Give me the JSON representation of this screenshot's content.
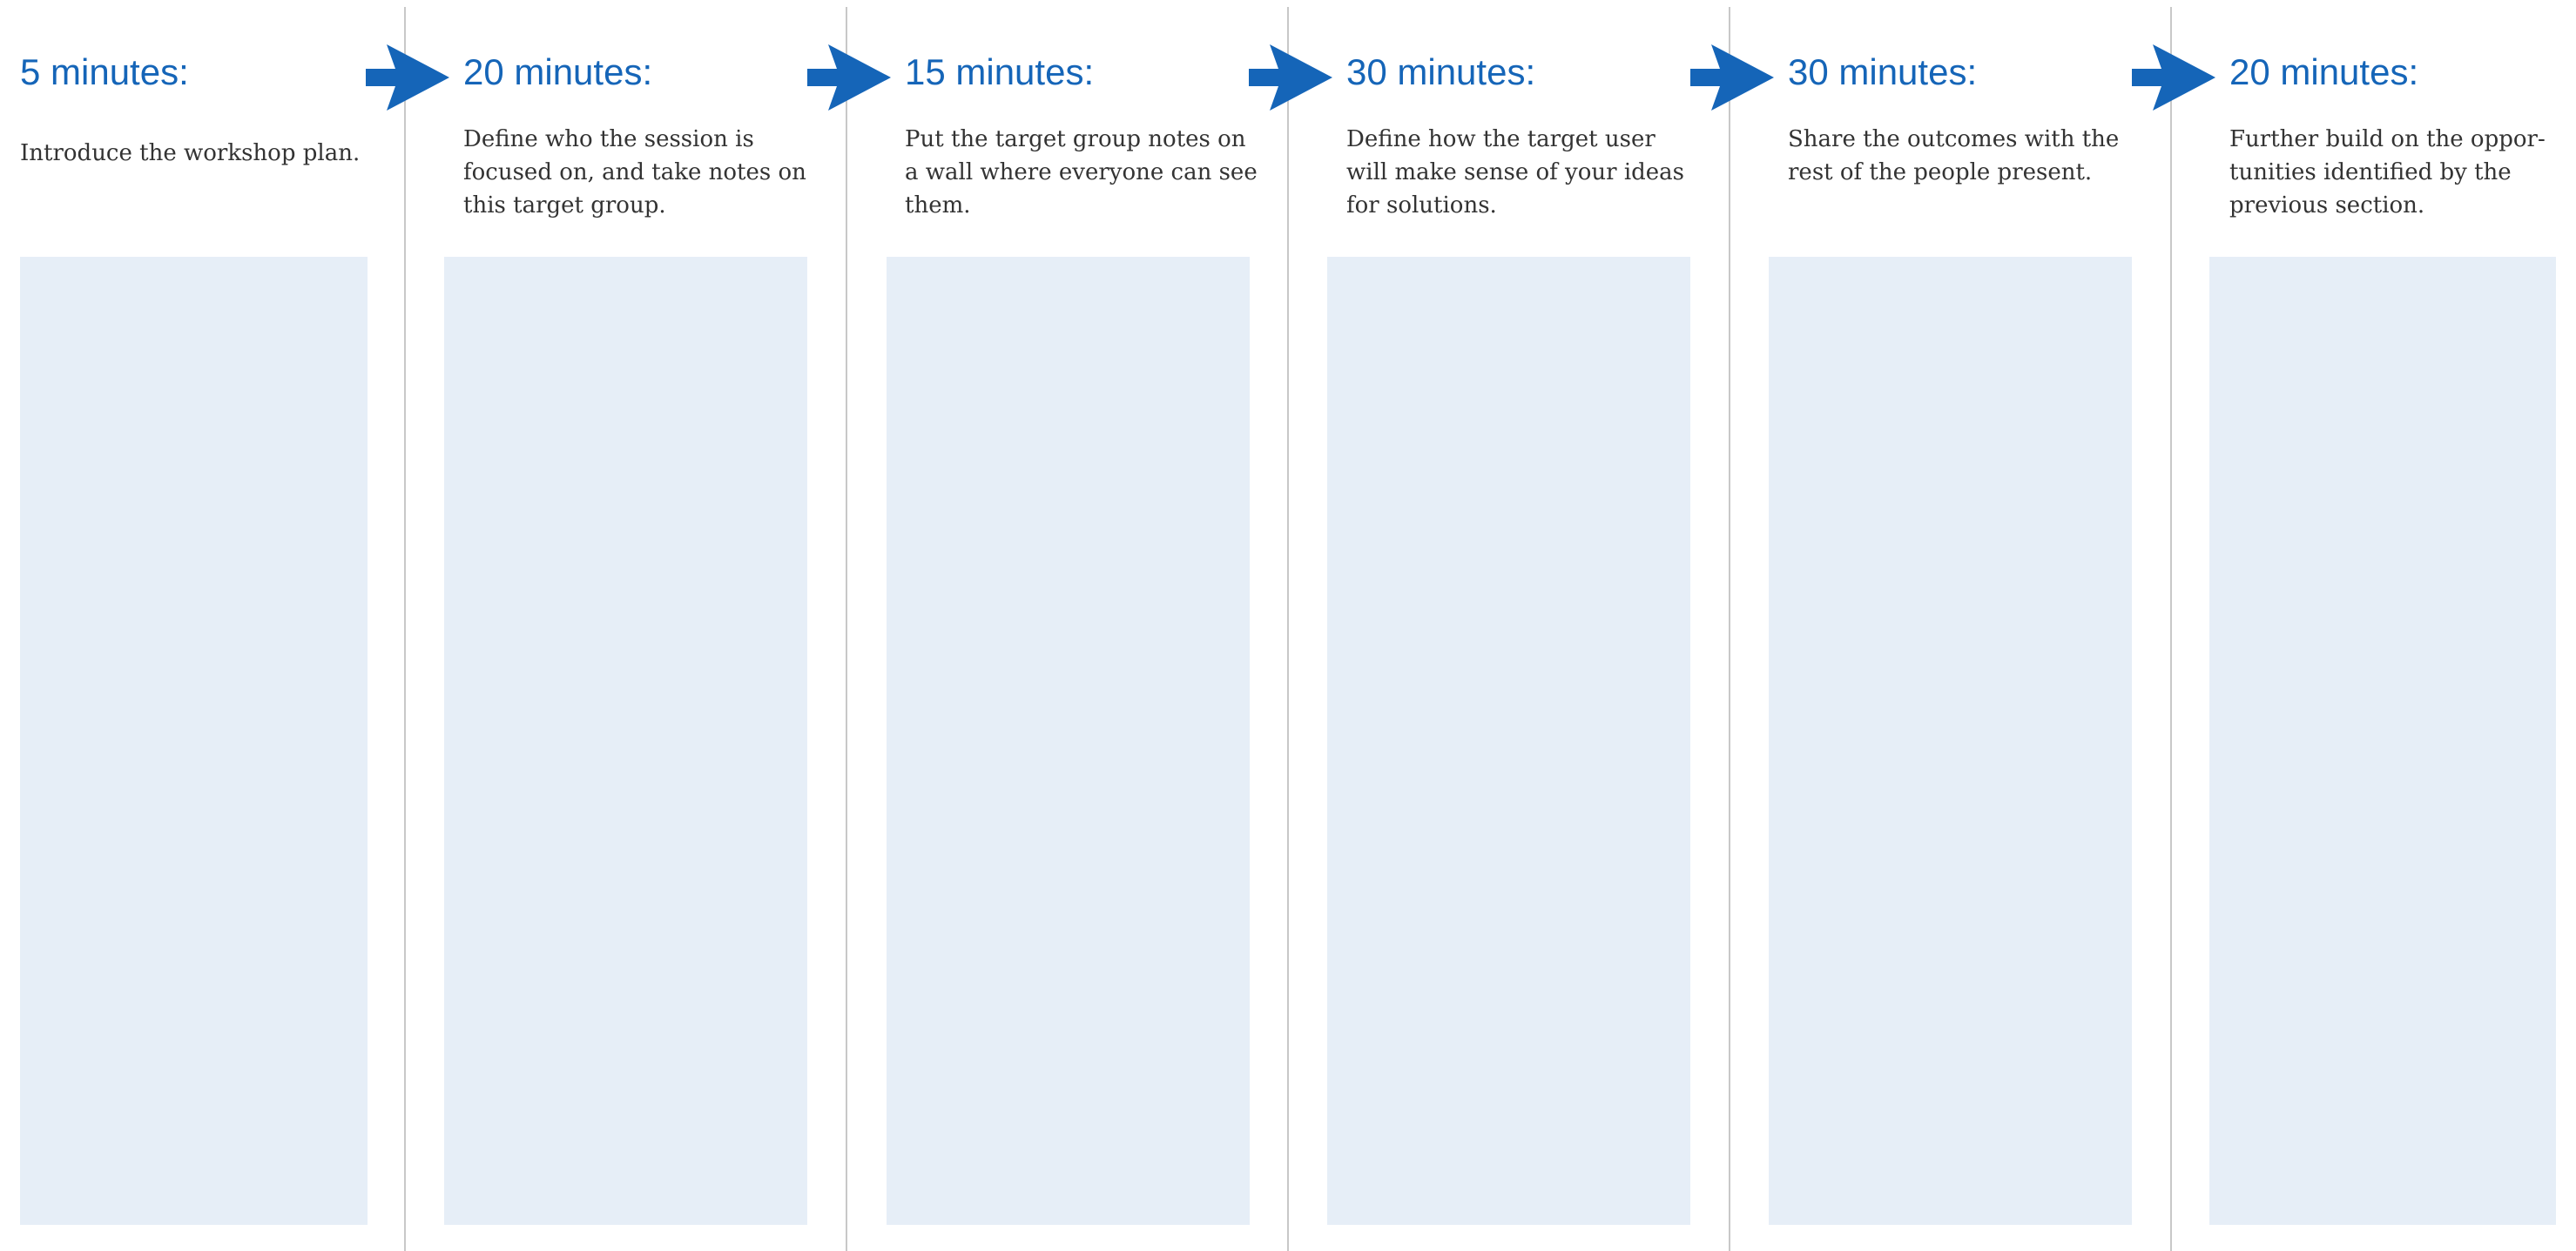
{
  "accent_color": "#1565b8",
  "note_area_color": "#e6eef7",
  "steps": [
    {
      "duration": "5 minutes:",
      "description": "Introduce the workshop plan."
    },
    {
      "duration": "20 minutes:",
      "description": "Define who the session is\nfocused on, and take notes on\nthis target group."
    },
    {
      "duration": "15 minutes:",
      "description": "Put the target group notes on\na wall where everyone can see\nthem."
    },
    {
      "duration": "30 minutes:",
      "description": "Define  how the target user\nwill make sense of your ideas\nfor solutions."
    },
    {
      "duration": "30 minutes:",
      "description": "Share the outcomes with the\nrest of the people present."
    },
    {
      "duration": "20 minutes:",
      "description": "Further  build on the oppor-\ntunities identified by the\nprevious section."
    }
  ],
  "arrow_icon": "right-arrow-icon"
}
